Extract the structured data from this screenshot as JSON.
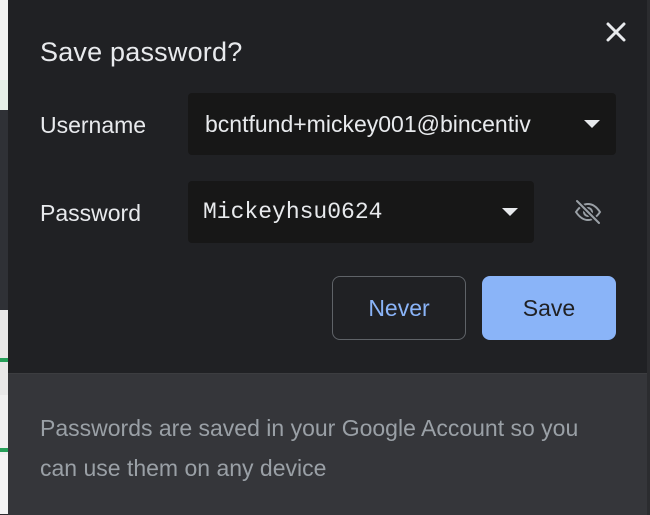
{
  "dialog": {
    "title": "Save password?",
    "close_icon": "close-icon",
    "username_label": "Username",
    "username_value": "bcntfund+mickey001@bincentiv",
    "password_label": "Password",
    "password_value": "Mickeyhsu0624",
    "visibility_icon": "eye-off-icon",
    "never_label": "Never",
    "save_label": "Save",
    "footer_text": "Passwords are saved in your Google Account so you can use them on any device"
  },
  "colors": {
    "dialog_bg": "#202124",
    "field_bg": "#171717",
    "footer_bg": "#35363a",
    "accent": "#8ab4f8",
    "text": "#e8eaed",
    "muted_text": "#9aa0a6"
  }
}
